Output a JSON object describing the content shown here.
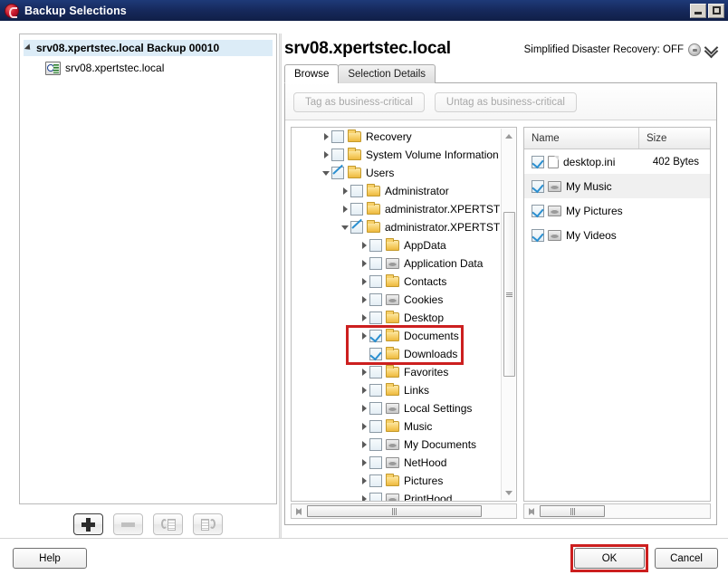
{
  "window": {
    "title": "Backup Selections",
    "icon": "app-logo-icon",
    "controls": {
      "minimize": "minimize-icon",
      "maximize": "maximize-icon"
    }
  },
  "left_panel": {
    "root": {
      "label": "srv08.xpertstec.local Backup 00010",
      "expanded": true,
      "selected": true
    },
    "child": {
      "label": "srv08.xpertstec.local",
      "icon": "server-icon"
    },
    "toolbar": [
      {
        "name": "add-button",
        "icon": "plus-icon",
        "enabled": true,
        "focused": true
      },
      {
        "name": "remove-button",
        "icon": "minus-icon",
        "enabled": false,
        "focused": false
      },
      {
        "name": "refresh-list-button",
        "icon": "refresh-list-icon",
        "enabled": false,
        "focused": false
      },
      {
        "name": "reload-list-button",
        "icon": "reload-list-icon",
        "enabled": false,
        "focused": false
      }
    ]
  },
  "right_panel": {
    "title": "srv08.xpertstec.local",
    "sdr": {
      "label": "Simplified Disaster Recovery: OFF",
      "toggle_icon": "sdr-toggle-icon",
      "expand_icon": "double-chevron-down-icon"
    },
    "tabs": [
      {
        "label": "Browse",
        "active": true
      },
      {
        "label": "Selection Details",
        "active": false
      }
    ],
    "critical_buttons": [
      {
        "label": "Tag as business-critical",
        "enabled": false
      },
      {
        "label": "Untag as business-critical",
        "enabled": false
      }
    ],
    "tree": [
      {
        "label": "Recovery",
        "indent": 1,
        "arrow": "right",
        "check": "none",
        "icon": "folder-icon",
        "highlight": false
      },
      {
        "label": "System Volume Information",
        "indent": 1,
        "arrow": "right",
        "check": "none",
        "icon": "folder-icon",
        "highlight": false
      },
      {
        "label": "Users",
        "indent": 1,
        "arrow": "down",
        "check": "partial",
        "icon": "folder-icon",
        "highlight": false
      },
      {
        "label": "Administrator",
        "indent": 2,
        "arrow": "right",
        "check": "none",
        "icon": "folder-icon",
        "highlight": false
      },
      {
        "label": "administrator.XPERTST",
        "indent": 2,
        "arrow": "right",
        "check": "none",
        "icon": "folder-icon",
        "highlight": false
      },
      {
        "label": "administrator.XPERTST",
        "indent": 2,
        "arrow": "down",
        "check": "partial",
        "icon": "folder-icon",
        "highlight": false
      },
      {
        "label": "AppData",
        "indent": 3,
        "arrow": "right",
        "check": "none",
        "icon": "folder-icon",
        "highlight": false
      },
      {
        "label": "Application Data",
        "indent": 3,
        "arrow": "right",
        "check": "none",
        "icon": "shortcut-icon",
        "highlight": false
      },
      {
        "label": "Contacts",
        "indent": 3,
        "arrow": "right",
        "check": "none",
        "icon": "folder-icon",
        "highlight": false
      },
      {
        "label": "Cookies",
        "indent": 3,
        "arrow": "right",
        "check": "none",
        "icon": "shortcut-icon",
        "highlight": false
      },
      {
        "label": "Desktop",
        "indent": 3,
        "arrow": "right",
        "check": "none",
        "icon": "folder-icon",
        "highlight": false
      },
      {
        "label": "Documents",
        "indent": 3,
        "arrow": "right",
        "check": "checked",
        "icon": "folder-icon",
        "highlight": true
      },
      {
        "label": "Downloads",
        "indent": 3,
        "arrow": "none",
        "check": "checked",
        "icon": "folder-icon",
        "highlight": true
      },
      {
        "label": "Favorites",
        "indent": 3,
        "arrow": "right",
        "check": "none",
        "icon": "folder-icon",
        "highlight": false
      },
      {
        "label": "Links",
        "indent": 3,
        "arrow": "right",
        "check": "none",
        "icon": "folder-icon",
        "highlight": false
      },
      {
        "label": "Local Settings",
        "indent": 3,
        "arrow": "right",
        "check": "none",
        "icon": "shortcut-icon",
        "highlight": false
      },
      {
        "label": "Music",
        "indent": 3,
        "arrow": "right",
        "check": "none",
        "icon": "folder-icon",
        "highlight": false
      },
      {
        "label": "My Documents",
        "indent": 3,
        "arrow": "right",
        "check": "none",
        "icon": "shortcut-icon",
        "highlight": false
      },
      {
        "label": "NetHood",
        "indent": 3,
        "arrow": "right",
        "check": "none",
        "icon": "shortcut-icon",
        "highlight": false
      },
      {
        "label": "Pictures",
        "indent": 3,
        "arrow": "right",
        "check": "none",
        "icon": "folder-icon",
        "highlight": false
      },
      {
        "label": "PrintHood",
        "indent": 3,
        "arrow": "right",
        "check": "none",
        "icon": "shortcut-icon",
        "highlight": false
      }
    ],
    "list": {
      "columns": [
        "Name",
        "Size"
      ],
      "rows": [
        {
          "name": "desktop.ini",
          "size": "402 Bytes",
          "checked": true,
          "icon": "file-icon",
          "alt": false
        },
        {
          "name": "My Music",
          "size": "",
          "checked": true,
          "icon": "shortcut-icon",
          "alt": true
        },
        {
          "name": "My Pictures",
          "size": "",
          "checked": true,
          "icon": "shortcut-icon",
          "alt": false
        },
        {
          "name": "My Videos",
          "size": "",
          "checked": true,
          "icon": "shortcut-icon",
          "alt": false
        }
      ]
    }
  },
  "footer": {
    "help_label": "Help",
    "ok_label": "OK",
    "cancel_label": "Cancel",
    "ok_highlighted": true
  },
  "colors": {
    "titlebar": "#16295c",
    "highlight_red": "#cc1f1f",
    "check_blue": "#2a8fd0",
    "folder_yellow": "#f7d069",
    "selection_blue": "#dcecf7"
  }
}
